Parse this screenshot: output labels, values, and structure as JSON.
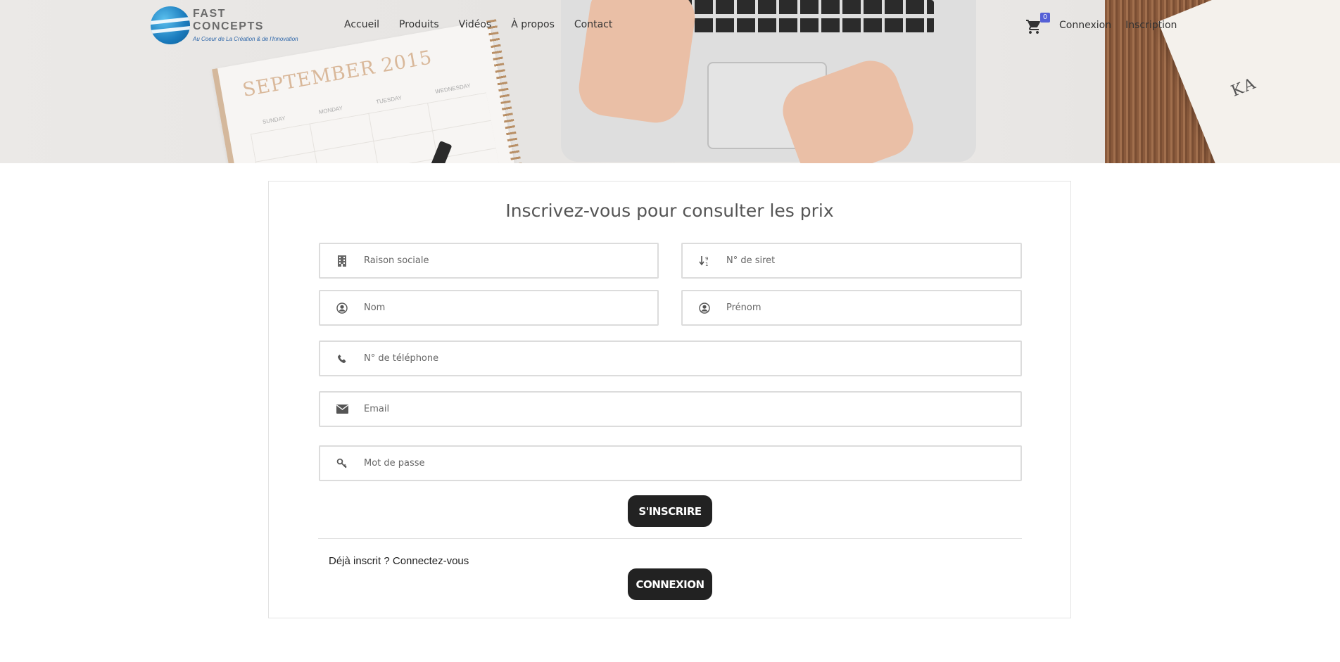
{
  "brand": {
    "name": "FAST CONCEPTS",
    "tagline": "Au Coeur de La Création & de l'Innovation"
  },
  "hero": {
    "calendar_title": "SEPTEMBER 2015",
    "calendar_days": [
      "SUNDAY",
      "MONDAY",
      "TUESDAY",
      "WEDNESDAY"
    ],
    "book_text": "KA"
  },
  "nav": {
    "items": [
      "Accueil",
      "Produits",
      "Vidéos",
      "À propos",
      "Contact"
    ],
    "cart_count": "0",
    "login": "Connexion",
    "register": "Inscription"
  },
  "form": {
    "title": "Inscrivez-vous pour consulter les prix",
    "fields": {
      "company": {
        "placeholder": "Raison sociale",
        "icon": "building-icon"
      },
      "siret": {
        "placeholder": "N° de siret",
        "icon": "sort-numeric-icon"
      },
      "lastname": {
        "placeholder": "Nom",
        "icon": "user-circle-icon"
      },
      "firstname": {
        "placeholder": "Prénom",
        "icon": "user-circle-icon"
      },
      "phone": {
        "placeholder": "N° de téléphone",
        "icon": "phone-icon"
      },
      "email": {
        "placeholder": "Email",
        "icon": "envelope-icon"
      },
      "password": {
        "placeholder": "Mot de passe",
        "icon": "key-icon"
      }
    },
    "submit": "S'INSCRIRE",
    "already_text": "Déjà inscrit ? Connectez-vous",
    "login_button": "CONNEXION"
  },
  "colors": {
    "button_bg": "#222222",
    "cart_badge": "#5560d6",
    "logo_blue": "#1a7bbd"
  }
}
